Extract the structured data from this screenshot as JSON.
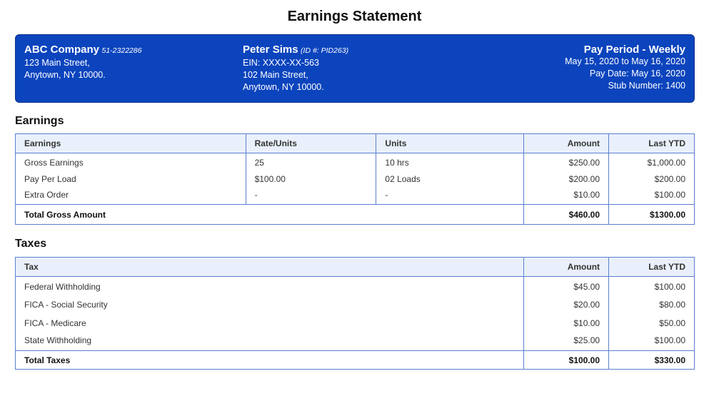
{
  "title": "Earnings Statement",
  "company": {
    "name": "ABC Company",
    "ein": "51-2322286",
    "address1": "123 Main Street,",
    "address2": "Anytown, NY 10000."
  },
  "employee": {
    "name": "Peter Sims",
    "id": "(ID #: PID263)",
    "ein": "EIN: XXXX-XX-563",
    "address1": "102 Main Street,",
    "address2": "Anytown, NY 10000."
  },
  "pay_period": {
    "title": "Pay Period - Weekly",
    "range": "May 15, 2020 to May 16, 2020",
    "pay_date": "Pay Date: May 16, 2020",
    "stub": "Stub Number: 1400"
  },
  "earnings": {
    "section_title": "Earnings",
    "headers": [
      "Earnings",
      "Rate/Units",
      "Units",
      "Amount",
      "Last YTD"
    ],
    "rows": [
      [
        "Gross Earnings",
        "25",
        "10 hrs",
        "$250.00",
        "$1,000.00"
      ],
      [
        "Pay Per Load",
        "$100.00",
        "02 Loads",
        "$200.00",
        "$200.00"
      ],
      [
        "Extra Order",
        "-",
        "-",
        "$10.00",
        "$100.00"
      ]
    ],
    "total": {
      "label": "Total Gross Amount",
      "amount": "$460.00",
      "ytd": "$1300.00"
    }
  },
  "taxes": {
    "section_title": "Taxes",
    "headers": [
      "Tax",
      "Amount",
      "Last YTD"
    ],
    "rows": [
      [
        "Federal Withholding",
        "$45.00",
        "$100.00"
      ],
      [
        "FICA - Social Security",
        "$20.00",
        "$80.00"
      ],
      [
        "FICA - Medicare",
        "$10.00",
        "$50.00"
      ],
      [
        "State Withholding",
        "$25.00",
        "$100.00"
      ]
    ],
    "total": {
      "label": "Total Taxes",
      "amount": "$100.00",
      "ytd": "$330.00"
    }
  },
  "colors": {
    "header_bg": "#0c44bd",
    "table_border": "#5b7fd0",
    "table_header_bg": "#eaf0fb"
  }
}
